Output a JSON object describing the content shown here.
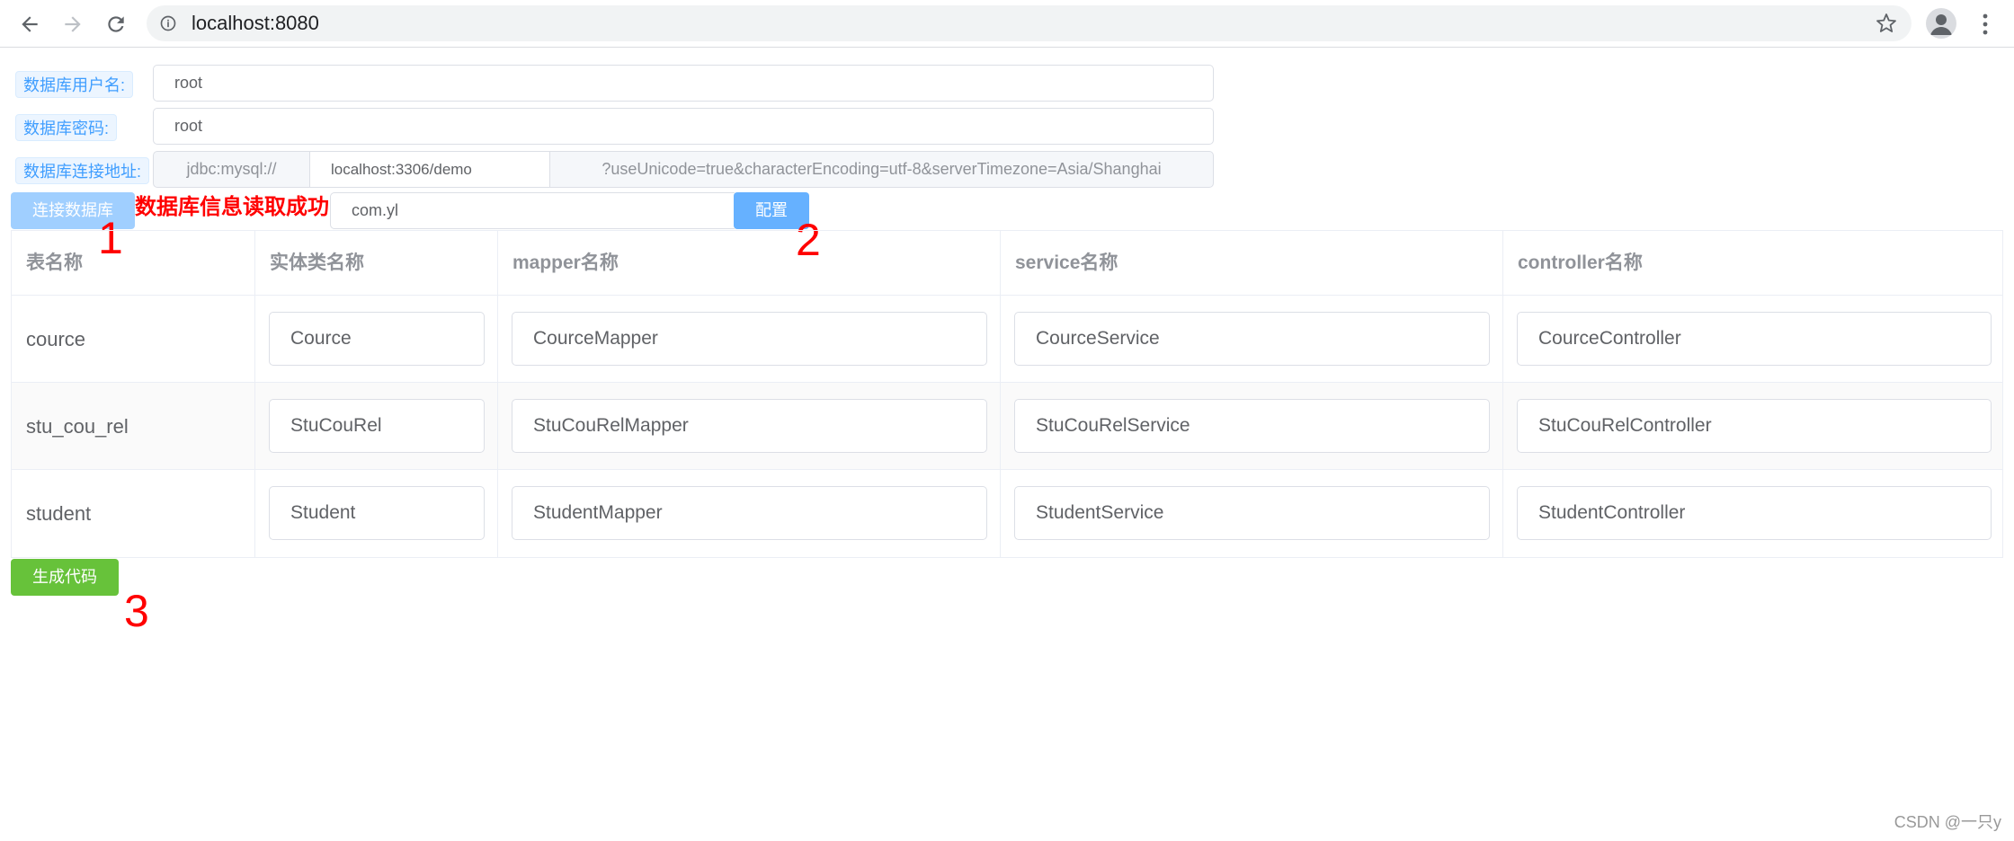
{
  "browser": {
    "url": "localhost:8080"
  },
  "form": {
    "username_label": "数据库用户名:",
    "username_value": "root",
    "password_label": "数据库密码:",
    "password_value": "root",
    "url_label": "数据库连接地址:",
    "url_prefix": "jdbc:mysql://",
    "url_host": "localhost:3306/demo",
    "url_suffix": "?useUnicode=true&characterEncoding=utf-8&serverTimezone=Asia/Shanghai",
    "connect_button": "连接数据库",
    "success_message": "数据库信息读取成功",
    "package_value": "com.yl",
    "config_button": "配置"
  },
  "table": {
    "headers": [
      "表名称",
      "实体类名称",
      "mapper名称",
      "service名称",
      "controller名称"
    ],
    "rows": [
      {
        "table": "cource",
        "entity": "Cource",
        "mapper": "CourceMapper",
        "service": "CourceService",
        "controller": "CourceController"
      },
      {
        "table": "stu_cou_rel",
        "entity": "StuCouRel",
        "mapper": "StuCouRelMapper",
        "service": "StuCouRelService",
        "controller": "StuCouRelController"
      },
      {
        "table": "student",
        "entity": "Student",
        "mapper": "StudentMapper",
        "service": "StudentService",
        "controller": "StudentController"
      }
    ]
  },
  "generate_button": "生成代码",
  "annotations": {
    "marker1": "1",
    "marker2": "2",
    "marker3": "3"
  },
  "watermark": "CSDN @一只y",
  "colors": {
    "primary": "#409eff",
    "success": "#67c23a",
    "annotation": "#ff0000"
  }
}
